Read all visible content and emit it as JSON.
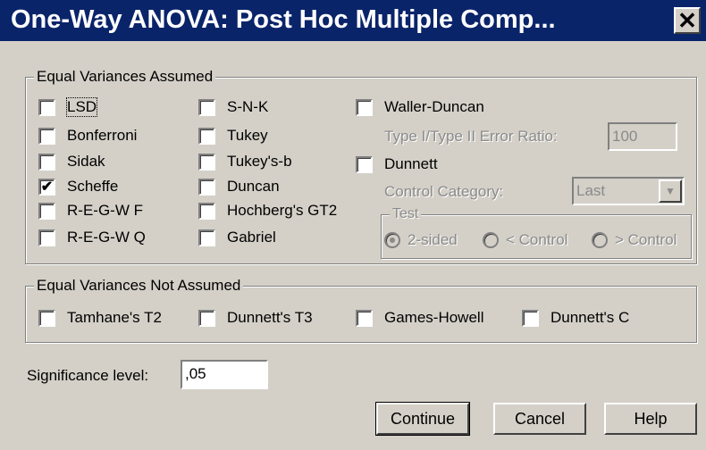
{
  "window": {
    "title": "One-Way ANOVA: Post Hoc Multiple Comp...",
    "close_glyph": "✕"
  },
  "equal_assumed": {
    "legend": "Equal Variances Assumed",
    "col1": [
      {
        "label": "LSD",
        "checked": false
      },
      {
        "label": "Bonferroni",
        "checked": false
      },
      {
        "label": "Sidak",
        "checked": false
      },
      {
        "label": "Scheffe",
        "checked": true
      },
      {
        "label": "R-E-G-W F",
        "checked": false
      },
      {
        "label": "R-E-G-W Q",
        "checked": false
      }
    ],
    "col2": [
      {
        "label": "S-N-K",
        "checked": false
      },
      {
        "label": "Tukey",
        "checked": false
      },
      {
        "label": "Tukey's-b",
        "checked": false
      },
      {
        "label": "Duncan",
        "checked": false
      },
      {
        "label": "Hochberg's GT2",
        "checked": false
      },
      {
        "label": "Gabriel",
        "checked": false
      }
    ],
    "waller": {
      "label": "Waller-Duncan",
      "checked": false
    },
    "ratio_label": "Type I/Type II Error Ratio:",
    "ratio_value": "100",
    "dunnett": {
      "label": "Dunnett",
      "checked": false
    },
    "control_label": "Control Category:",
    "control_value": "Last",
    "test_legend": "Test",
    "tests": [
      "2-sided",
      "< Control",
      "> Control"
    ]
  },
  "not_assumed": {
    "legend": "Equal Variances Not Assumed",
    "items": [
      {
        "label": "Tamhane's T2",
        "checked": false
      },
      {
        "label": "Dunnett's T3",
        "checked": false
      },
      {
        "label": "Games-Howell",
        "checked": false
      },
      {
        "label": "Dunnett's C",
        "checked": false
      }
    ]
  },
  "significance": {
    "label": "Significance level:",
    "value": ",05"
  },
  "buttons": {
    "continue": "Continue",
    "cancel": "Cancel",
    "help": "Help"
  },
  "check_glyph": "✔"
}
